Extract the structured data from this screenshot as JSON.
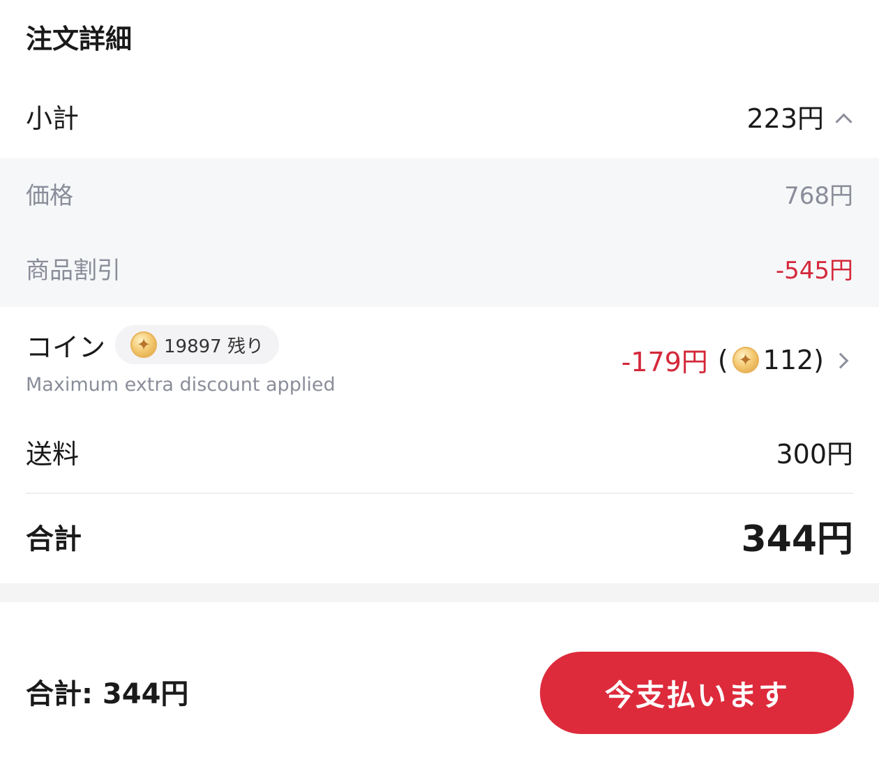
{
  "section_title": "注文詳細",
  "subtotal": {
    "label": "小計",
    "value": "223円"
  },
  "breakdown": {
    "price": {
      "label": "価格",
      "value": "768円"
    },
    "discount": {
      "label": "商品割引",
      "value": "-545円"
    }
  },
  "coin": {
    "label": "コイン",
    "badge": "19897 残り",
    "subtext": "Maximum extra discount applied",
    "amount": "-179円",
    "open_paren": "(",
    "coins_used": "112)",
    "coin_icon": "gold-coin-icon"
  },
  "shipping": {
    "label": "送料",
    "value": "300円"
  },
  "total": {
    "label": "合計",
    "value": "344円"
  },
  "footer": {
    "total_text": "合計: 344円",
    "pay_button": "今支払います"
  },
  "colors": {
    "accent": "#dd2b3c",
    "discount_red": "#d4283a",
    "muted": "#8a8d99"
  }
}
